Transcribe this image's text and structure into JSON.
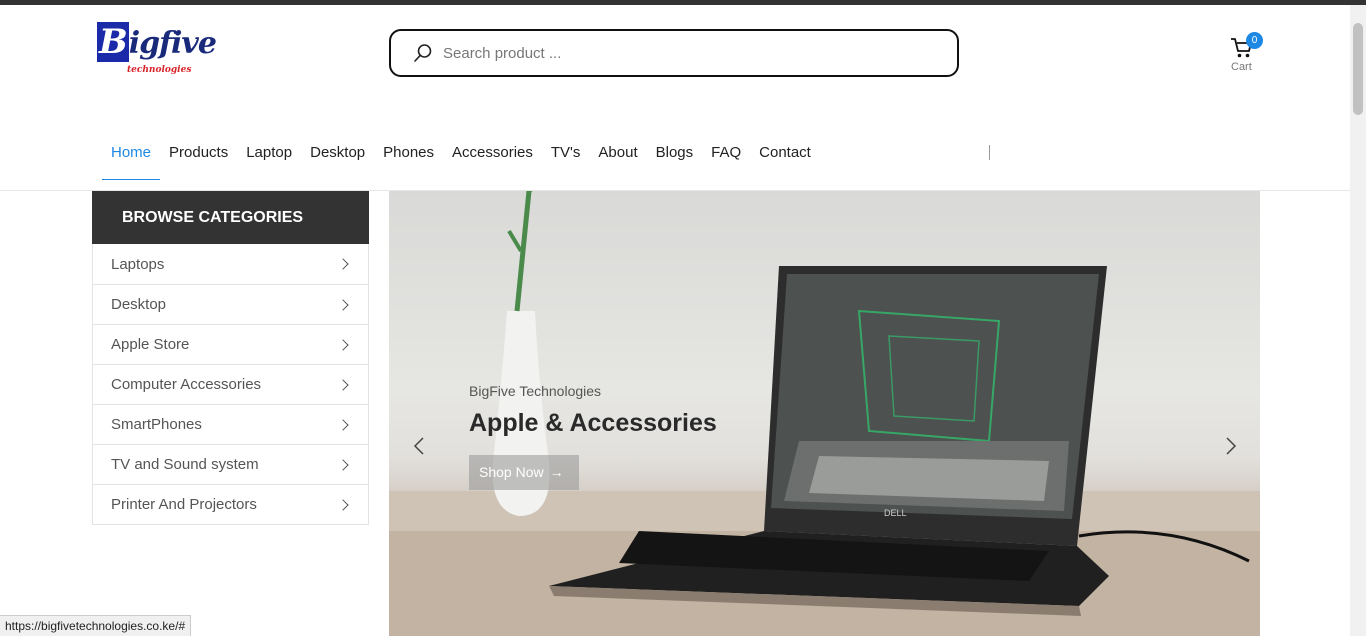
{
  "logo": {
    "main": "Bigfive",
    "big_letter": "B",
    "rest": "igfive",
    "sub": "technologies"
  },
  "search": {
    "placeholder": "Search product ...",
    "value": ""
  },
  "cart": {
    "label": "Cart",
    "count": "0"
  },
  "nav": {
    "items": [
      {
        "label": "Home",
        "active": true
      },
      {
        "label": "Products"
      },
      {
        "label": "Laptop"
      },
      {
        "label": "Desktop"
      },
      {
        "label": "Phones"
      },
      {
        "label": "Accessories"
      },
      {
        "label": "TV's"
      },
      {
        "label": "About"
      },
      {
        "label": "Blogs"
      },
      {
        "label": "FAQ"
      },
      {
        "label": "Contact"
      }
    ]
  },
  "categories": {
    "heading": "BROWSE CATEGORIES",
    "items": [
      {
        "label": "Laptops"
      },
      {
        "label": "Desktop"
      },
      {
        "label": "Apple Store"
      },
      {
        "label": "Computer Accessories"
      },
      {
        "label": "SmartPhones"
      },
      {
        "label": "TV and Sound system"
      },
      {
        "label": "Printer And Projectors"
      }
    ]
  },
  "banner": {
    "subtitle": "BigFive Technologies",
    "title": "Apple & Accessories",
    "button_label": "Shop Now",
    "button_arrow": "→",
    "laptop_brand": "DELL"
  },
  "status_bar": {
    "url": "https://bigfivetechnologies.co.ke/#"
  },
  "colors": {
    "accent": "#1e88e5",
    "dark": "#333333"
  }
}
